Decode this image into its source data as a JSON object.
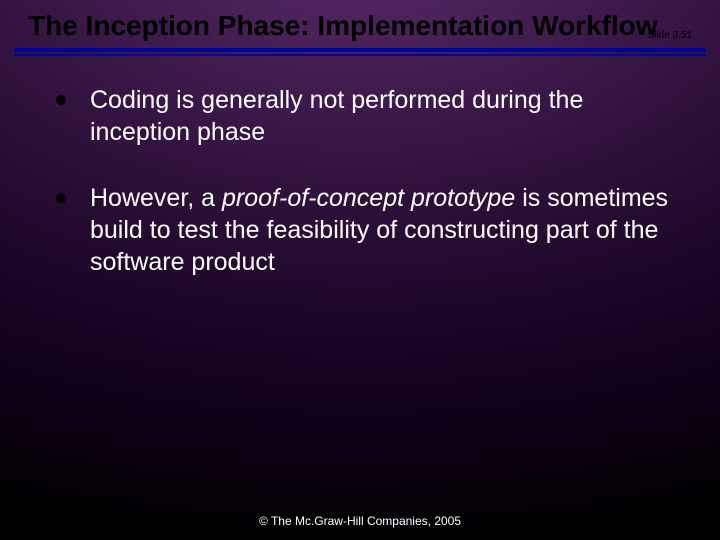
{
  "title": "The Inception Phase: Implementation Workflow",
  "slide_number": "Slide 3.51",
  "bullets": [
    {
      "plain": "Coding is generally not performed during the inception phase"
    },
    {
      "pre": "However, a ",
      "em": "proof-of-concept prototype",
      "post": " is sometimes build to test the feasibility of constructing part of the software product"
    }
  ],
  "footer": "© The Mc.Graw-Hill Companies, 2005"
}
